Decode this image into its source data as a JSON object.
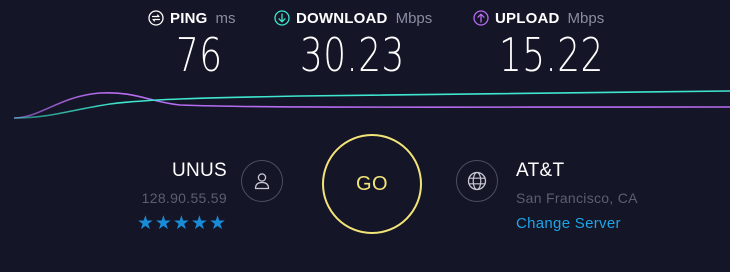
{
  "metrics": {
    "ping": {
      "label": "PING",
      "unit": "ms",
      "value": "76",
      "icon": "ping-icon",
      "color": "#ffffff"
    },
    "download": {
      "label": "DOWNLOAD",
      "unit": "Mbps",
      "value": "30.23",
      "icon": "download-icon",
      "color": "#3ee6cf"
    },
    "upload": {
      "label": "UPLOAD",
      "unit": "Mbps",
      "value": "15.22",
      "icon": "upload-icon",
      "color": "#b56cf0"
    }
  },
  "isp": {
    "name": "UNUS",
    "ip": "128.90.55.59",
    "rating": 5,
    "stars": "★★★★★",
    "icon": "user-icon"
  },
  "go_label": "GO",
  "server": {
    "name": "AT&T",
    "location": "San Francisco, CA",
    "change_label": "Change Server",
    "icon": "globe-icon"
  },
  "colors": {
    "background": "#141526",
    "go_ring": "#f3e47a",
    "download_line": "#3ee6cf",
    "upload_line": "#b56cf0",
    "link": "#1ea4e8",
    "stars": "#1a8bd6"
  }
}
